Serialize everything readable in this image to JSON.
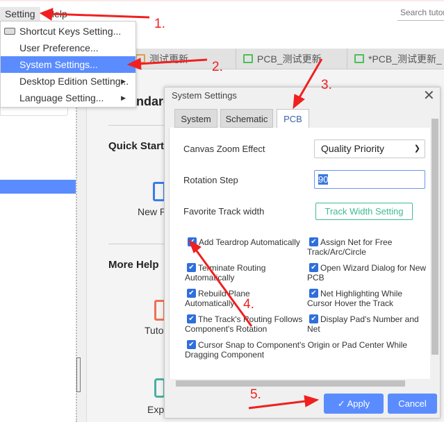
{
  "menubar": {
    "setting": "Setting",
    "help": "Help",
    "search_placeholder": "Search tutorial"
  },
  "dropdown": {
    "items": [
      {
        "label": "Shortcut Keys Setting...",
        "icon": "keyboard-icon"
      },
      {
        "label": "User Preference..."
      },
      {
        "label": "System Settings...",
        "selected": true
      },
      {
        "label": "Desktop Edition Setting...",
        "submenu": true
      },
      {
        "label": "Language Setting...",
        "submenu": true
      }
    ]
  },
  "doc_tabs": [
    {
      "label": "测试更新"
    },
    {
      "label": "PCB_测试更新"
    },
    {
      "label": "*PCB_测试更新_"
    }
  ],
  "main": {
    "heading": "Standard",
    "quick_start": "Quick Start",
    "new_project": "New P",
    "more_help": "More Help",
    "tutorial": "Tuto",
    "explore": "Exp"
  },
  "dialog": {
    "title": "System Settings",
    "tabs": [
      "System",
      "Schematic",
      "PCB"
    ],
    "active_tab": "PCB",
    "canvas_zoom_label": "Canvas Zoom Effect",
    "canvas_zoom_value": "Quality Priority",
    "rotation_label": "Rotation Step",
    "rotation_value": "90",
    "track_width_label": "Favorite Track width",
    "track_width_button": "Track Width Setting",
    "checkboxes": [
      {
        "label": "Add Teardrop Automatically",
        "checked": true
      },
      {
        "label": "Assign Net for Free Track/Arc/Circle",
        "checked": true
      },
      {
        "label": "Terminate Routing Automatically",
        "checked": true
      },
      {
        "label": "Open Wizard Dialog for New PCB",
        "checked": true
      },
      {
        "label": "Rebuild Plane Automatically",
        "checked": true
      },
      {
        "label": "Net Highlighting While Cursor Hover the Track",
        "checked": true
      },
      {
        "label": "The Track's Routing Follows Component's Rotation",
        "checked": true
      },
      {
        "label": "Display Pad's Number and Net",
        "checked": true
      },
      {
        "label": "Cursor Snap to Component's Origin or Pad Center While Dragging Component",
        "checked": true
      }
    ],
    "apply": "Apply",
    "cancel": "Cancel"
  },
  "annotations": [
    "1.",
    "2.",
    "3.",
    "4.",
    "5."
  ],
  "colors": {
    "accent": "#5b8cff",
    "annotation": "#f02020",
    "teal": "#3fba93"
  }
}
